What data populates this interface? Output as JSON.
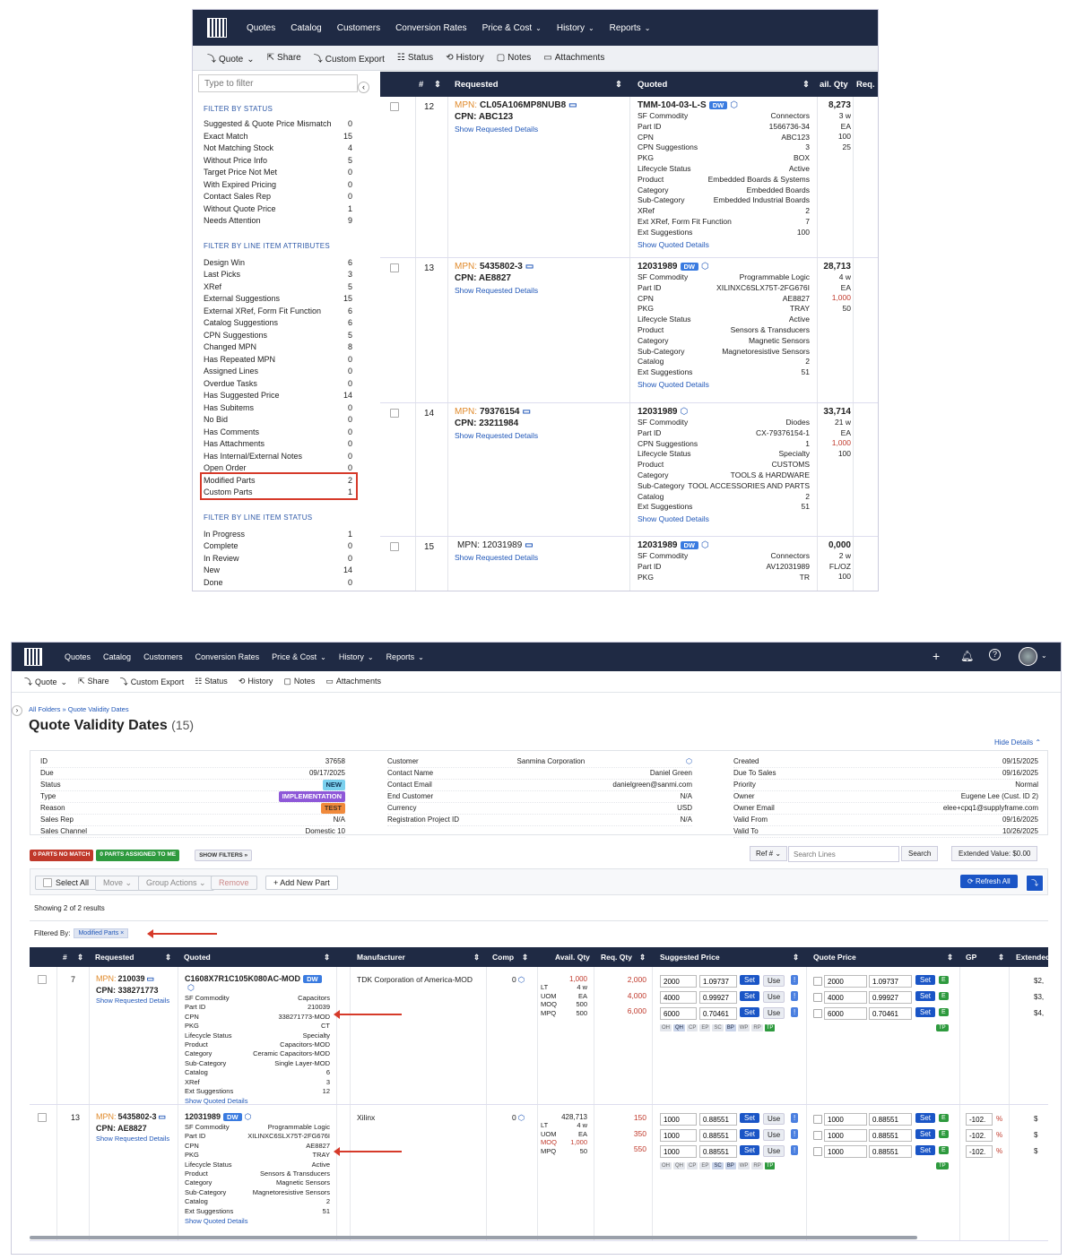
{
  "nav": {
    "items": [
      "Quotes",
      "Catalog",
      "Customers",
      "Conversion Rates",
      "Price & Cost",
      "History",
      "Reports"
    ]
  },
  "toolbar": {
    "items": [
      "Quote",
      "Share",
      "Custom Export",
      "Status",
      "History",
      "Notes",
      "Attachments"
    ]
  },
  "filter": {
    "placeholder": "Type to filter",
    "status_title": "FILTER BY STATUS",
    "status": [
      [
        "Suggested & Quote Price Mismatch",
        "0"
      ],
      [
        "Exact Match",
        "15"
      ],
      [
        "Not Matching Stock",
        "4"
      ],
      [
        "Without Price Info",
        "5"
      ],
      [
        "Target Price Not Met",
        "0"
      ],
      [
        "With Expired Pricing",
        "0"
      ],
      [
        "Contact Sales Rep",
        "0"
      ],
      [
        "Without Quote Price",
        "1"
      ],
      [
        "Needs Attention",
        "9"
      ]
    ],
    "attr_title": "FILTER BY LINE ITEM ATTRIBUTES",
    "attrs": [
      [
        "Design Win",
        "6"
      ],
      [
        "Last Picks",
        "3"
      ],
      [
        "XRef",
        "5"
      ],
      [
        "External Suggestions",
        "15"
      ],
      [
        "External XRef, Form Fit Function",
        "6"
      ],
      [
        "Catalog Suggestions",
        "6"
      ],
      [
        "CPN Suggestions",
        "5"
      ],
      [
        "Changed MPN",
        "8"
      ],
      [
        "Has Repeated MPN",
        "0"
      ],
      [
        "Assigned Lines",
        "0"
      ],
      [
        "Overdue Tasks",
        "0"
      ],
      [
        "Has Suggested Price",
        "14"
      ],
      [
        "Has Subitems",
        "0"
      ],
      [
        "No Bid",
        "0"
      ],
      [
        "Has Comments",
        "0"
      ],
      [
        "Has Attachments",
        "0"
      ],
      [
        "Has Internal/External Notes",
        "0"
      ],
      [
        "Open Order",
        "0"
      ],
      [
        "Modified Parts",
        "2"
      ],
      [
        "Custom Parts",
        "1"
      ]
    ],
    "ls_title": "FILTER BY LINE ITEM STATUS",
    "line_status": [
      [
        "In Progress",
        "1"
      ],
      [
        "Complete",
        "0"
      ],
      [
        "In Review",
        "0"
      ],
      [
        "New",
        "14"
      ],
      [
        "Done",
        "0"
      ],
      [
        "Rejected",
        "0"
      ]
    ]
  },
  "top_table": {
    "headers": [
      "#",
      "Requested",
      "Quoted",
      "ail. Qty",
      "Req."
    ],
    "rows": [
      {
        "num": "12",
        "mpn_label": "MPN:",
        "mpn": "CL05A106MP8NUB8",
        "cpn": "CPN: ABC123",
        "show_req": "Show Requested Details",
        "quoted": "TMM-104-03-L-S",
        "badge": "DW",
        "details": [
          [
            "SF Commodity",
            "Connectors"
          ],
          [
            "Part ID",
            "1566736-34"
          ],
          [
            "CPN",
            "ABC123"
          ],
          [
            "CPN Suggestions",
            "3"
          ],
          [
            "PKG",
            "BOX"
          ],
          [
            "Lifecycle Status",
            "Active"
          ],
          [
            "Product",
            "Embedded Boards & Systems"
          ],
          [
            "Category",
            "Embedded Boards"
          ],
          [
            "Sub-Category",
            "Embedded Industrial Boards"
          ],
          [
            "XRef",
            "2"
          ],
          [
            "Ext XRef, Form Fit Function",
            "7"
          ],
          [
            "Ext Suggestions",
            "100"
          ]
        ],
        "show_quoted": "Show Quoted Details",
        "qty": [
          "8,273",
          "3 w",
          "EA",
          "100",
          "25"
        ]
      },
      {
        "num": "13",
        "mpn_label": "MPN:",
        "mpn": "5435802-3",
        "cpn": "CPN: AE8827",
        "show_req": "Show Requested Details",
        "quoted": "12031989",
        "badge": "DW",
        "details": [
          [
            "SF Commodity",
            "Programmable Logic"
          ],
          [
            "Part ID",
            "XILINXC6SLX75T-2FG676I"
          ],
          [
            "CPN",
            "AE8827"
          ],
          [
            "PKG",
            "TRAY"
          ],
          [
            "Lifecycle Status",
            "Active"
          ],
          [
            "Product",
            "Sensors & Transducers"
          ],
          [
            "Category",
            "Magnetic Sensors"
          ],
          [
            "Sub-Category",
            "Magnetoresistive Sensors"
          ],
          [
            "Catalog",
            "2"
          ],
          [
            "Ext Suggestions",
            "51"
          ]
        ],
        "show_quoted": "Show Quoted Details",
        "qty": [
          "28,713",
          "4 w",
          "EA",
          "1,000",
          "50"
        ]
      },
      {
        "num": "14",
        "mpn_label": "MPN:",
        "mpn": "79376154",
        "cpn": "CPN: 23211984",
        "show_req": "Show Requested Details",
        "quoted": "12031989",
        "badge": "",
        "details": [
          [
            "SF Commodity",
            "Diodes"
          ],
          [
            "Part ID",
            "CX-79376154-1"
          ],
          [
            "CPN Suggestions",
            "1"
          ],
          [
            "Lifecycle Status",
            "Specialty"
          ],
          [
            "Product",
            "CUSTOMS"
          ],
          [
            "Category",
            "TOOLS & HARDWARE"
          ],
          [
            "Sub-Category",
            "TOOL ACCESSORIES AND PARTS"
          ],
          [
            "Catalog",
            "2"
          ],
          [
            "Ext Suggestions",
            "51"
          ]
        ],
        "show_quoted": "Show Quoted Details",
        "qty": [
          "33,714",
          "21 w",
          "EA",
          "1,000",
          "100"
        ]
      },
      {
        "num": "15",
        "mpn_label": "",
        "mpn": "MPN: 12031989",
        "cpn": "",
        "show_req": "Show Requested Details",
        "quoted": "12031989",
        "badge": "DW",
        "details": [
          [
            "SF Commodity",
            "Connectors"
          ],
          [
            "Part ID",
            "AV12031989"
          ],
          [
            "PKG",
            "TR"
          ]
        ],
        "show_quoted": "",
        "qty": [
          "0,000",
          "2 w",
          "FL/OZ",
          "100",
          ""
        ]
      }
    ]
  },
  "page": {
    "breadcrumb": "All Folders » Quote Validity Dates",
    "title": "Quote Validity Dates",
    "count": "(15)",
    "hide": "Hide Details",
    "left": [
      [
        "ID",
        "37658"
      ],
      [
        "Due",
        "09/17/2025"
      ],
      [
        "Status",
        "NEW"
      ],
      [
        "Type",
        "IMPLEMENTATION"
      ],
      [
        "Reason",
        "TEST"
      ],
      [
        "Sales Rep",
        "N/A"
      ],
      [
        "Sales Channel",
        "Domestic 10"
      ]
    ],
    "mid": [
      [
        "Customer",
        "Sanmina Corporation"
      ],
      [
        "Contact Name",
        "Daniel Green"
      ],
      [
        "Contact Email",
        "danielgreen@sanmi.com"
      ],
      [
        "End Customer",
        "N/A"
      ],
      [
        "Currency",
        "USD"
      ],
      [
        "Registration Project ID",
        "N/A"
      ]
    ],
    "right": [
      [
        "Created",
        "09/15/2025"
      ],
      [
        "Due To Sales",
        "09/16/2025"
      ],
      [
        "Priority",
        "Normal"
      ],
      [
        "Owner",
        "Eugene Lee (Cust. ID 2)"
      ],
      [
        "Owner Email",
        "elee+cpq1@supplyframe.com"
      ],
      [
        "Valid From",
        "09/16/2025"
      ],
      [
        "Valid To",
        "10/26/2025"
      ]
    ],
    "chip_red": "0 PARTS NO MATCH",
    "chip_green": "0 PARTS ASSIGNED TO ME",
    "show_filters": "SHOW FILTERS »",
    "ref": "Ref #",
    "search_ph": "Search Lines",
    "search": "Search",
    "ext_value": "Extended Value: $0.00",
    "select_all": "Select All",
    "move": "Move",
    "group": "Group Actions",
    "remove": "Remove",
    "add": "+ Add New Part",
    "refresh": "Refresh All",
    "showing": "Showing 2 of 2 results",
    "filtered_by": "Filtered By:",
    "filter_chip": "Modified Parts"
  },
  "bottom_table": {
    "headers": [
      "#",
      "Requested",
      "Quoted",
      "Manufacturer",
      "Comp",
      "Avail. Qty",
      "Req. Qty",
      "Suggested Price",
      "Quote Price",
      "GP",
      "Extended"
    ],
    "rows": [
      {
        "num": "7",
        "mpn_label": "MPN:",
        "mpn": "210039",
        "cpn": "CPN: 338271773",
        "show_req": "Show Requested Details",
        "quoted": "C1608X7R1C105K080AC-MOD",
        "badge": "DW",
        "details": [
          [
            "SF Commodity",
            "Capacitors"
          ],
          [
            "Part ID",
            "210039"
          ],
          [
            "CPN",
            "338271773-MOD"
          ],
          [
            "PKG",
            "CT"
          ],
          [
            "Lifecycle Status",
            "Specialty"
          ],
          [
            "Product",
            "Capacitors-MOD"
          ],
          [
            "Category",
            "Ceramic Capacitors-MOD"
          ],
          [
            "Sub-Category",
            "Single Layer-MOD"
          ],
          [
            "Catalog",
            "6"
          ],
          [
            "XRef",
            "3"
          ],
          [
            "Ext Suggestions",
            "12"
          ]
        ],
        "show_quoted": "Show Quoted Details",
        "mfr": "TDK Corporation of America-MOD",
        "comp": "0",
        "avail": "1,000",
        "avail_kv": [
          [
            "LT",
            "4 w"
          ],
          [
            "UOM",
            "EA"
          ],
          [
            "MOQ",
            "500"
          ],
          [
            "MPQ",
            "500"
          ]
        ],
        "req": [
          "2,000",
          "4,000",
          "6,000"
        ],
        "prices": [
          [
            "2000",
            "1.09737"
          ],
          [
            "4000",
            "0.99927"
          ],
          [
            "6000",
            "0.70461"
          ]
        ],
        "gp": [],
        "ext": [
          "$2,",
          "$3,",
          "$4,"
        ]
      },
      {
        "num": "13",
        "mpn_label": "MPN:",
        "mpn": "5435802-3",
        "cpn": "CPN: AE8827",
        "show_req": "Show Requested Details",
        "quoted": "12031989",
        "badge": "DW",
        "details": [
          [
            "SF Commodity",
            "Programmable Logic"
          ],
          [
            "Part ID",
            "XILINXC6SLX75T-2FG676I"
          ],
          [
            "CPN",
            "AE8827"
          ],
          [
            "PKG",
            "TRAY"
          ],
          [
            "Lifecycle Status",
            "Active"
          ],
          [
            "Product",
            "Sensors & Transducers"
          ],
          [
            "Category",
            "Magnetic Sensors"
          ],
          [
            "Sub-Category",
            "Magnetoresistive Sensors"
          ],
          [
            "Catalog",
            "2"
          ],
          [
            "Ext Suggestions",
            "51"
          ]
        ],
        "show_quoted": "Show Quoted Details",
        "mfr": "Xilinx",
        "comp": "0",
        "avail": "428,713",
        "avail_kv": [
          [
            "LT",
            "4 w"
          ],
          [
            "UOM",
            "EA"
          ],
          [
            "MOQ",
            "1,000"
          ],
          [
            "MPQ",
            "50"
          ]
        ],
        "req": [
          "150",
          "350",
          "550"
        ],
        "prices": [
          [
            "1000",
            "0.88551"
          ],
          [
            "1000",
            "0.88551"
          ],
          [
            "1000",
            "0.88551"
          ]
        ],
        "gp": [
          "-102.",
          "-102.",
          "-102."
        ],
        "ext": [
          "$",
          "$",
          "$"
        ]
      }
    ],
    "tags": [
      "OH",
      "QH",
      "CP",
      "EP",
      "SC",
      "BP",
      "WP",
      "RP",
      "TP"
    ],
    "set": "Set",
    "use": "Use",
    "ex": "!",
    "e": "E",
    "tp": "TP",
    "pct": "%"
  },
  "colors": {
    "nav": "#1f2a44",
    "accent": "#1a55c6",
    "highlight": "#d63a2a"
  }
}
